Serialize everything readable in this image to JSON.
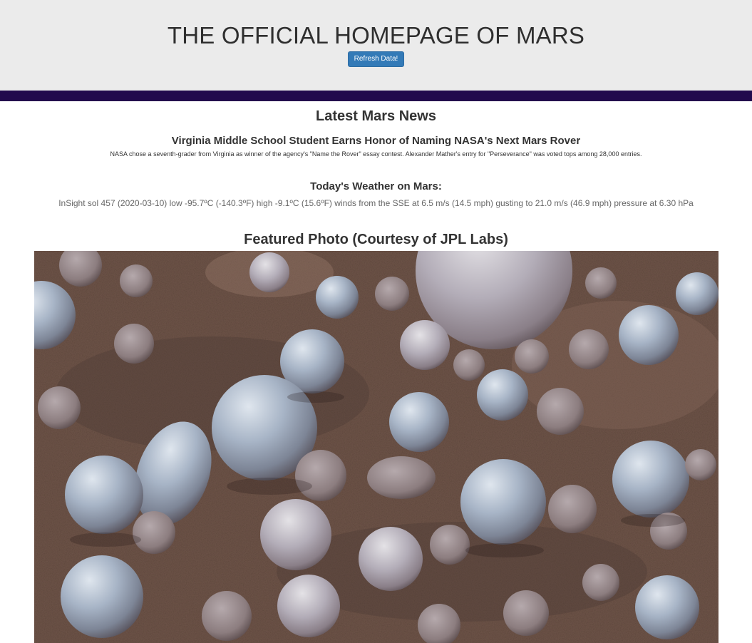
{
  "header": {
    "title": "THE OFFICIAL HOMEPAGE OF MARS",
    "refresh_button": "Refresh Data!"
  },
  "news": {
    "section_title": "Latest Mars News",
    "headline": "Virginia Middle School Student Earns Honor of Naming NASA's Next Mars Rover",
    "teaser": "NASA chose a seventh-grader from Virginia as winner of the agency's \"Name the Rover\" essay contest. Alexander Mather's entry for \"Perseverance\" was voted tops among 28,000 entries."
  },
  "weather": {
    "title": "Today's Weather on Mars:",
    "report": "InSight sol 457 (2020-03-10) low -95.7ºC (-140.3ºF) high -9.1ºC (15.6ºF) winds from the SSE at 6.5 m/s (14.5 mph) gusting to 21.0 m/s (46.9 mph) pressure at 6.30 hPa"
  },
  "featured": {
    "title": "Featured Photo (Courtesy of JPL Labs)"
  },
  "colors": {
    "header_bg": "#ebebeb",
    "divider": "#220a4d",
    "button": "#337ab7"
  }
}
